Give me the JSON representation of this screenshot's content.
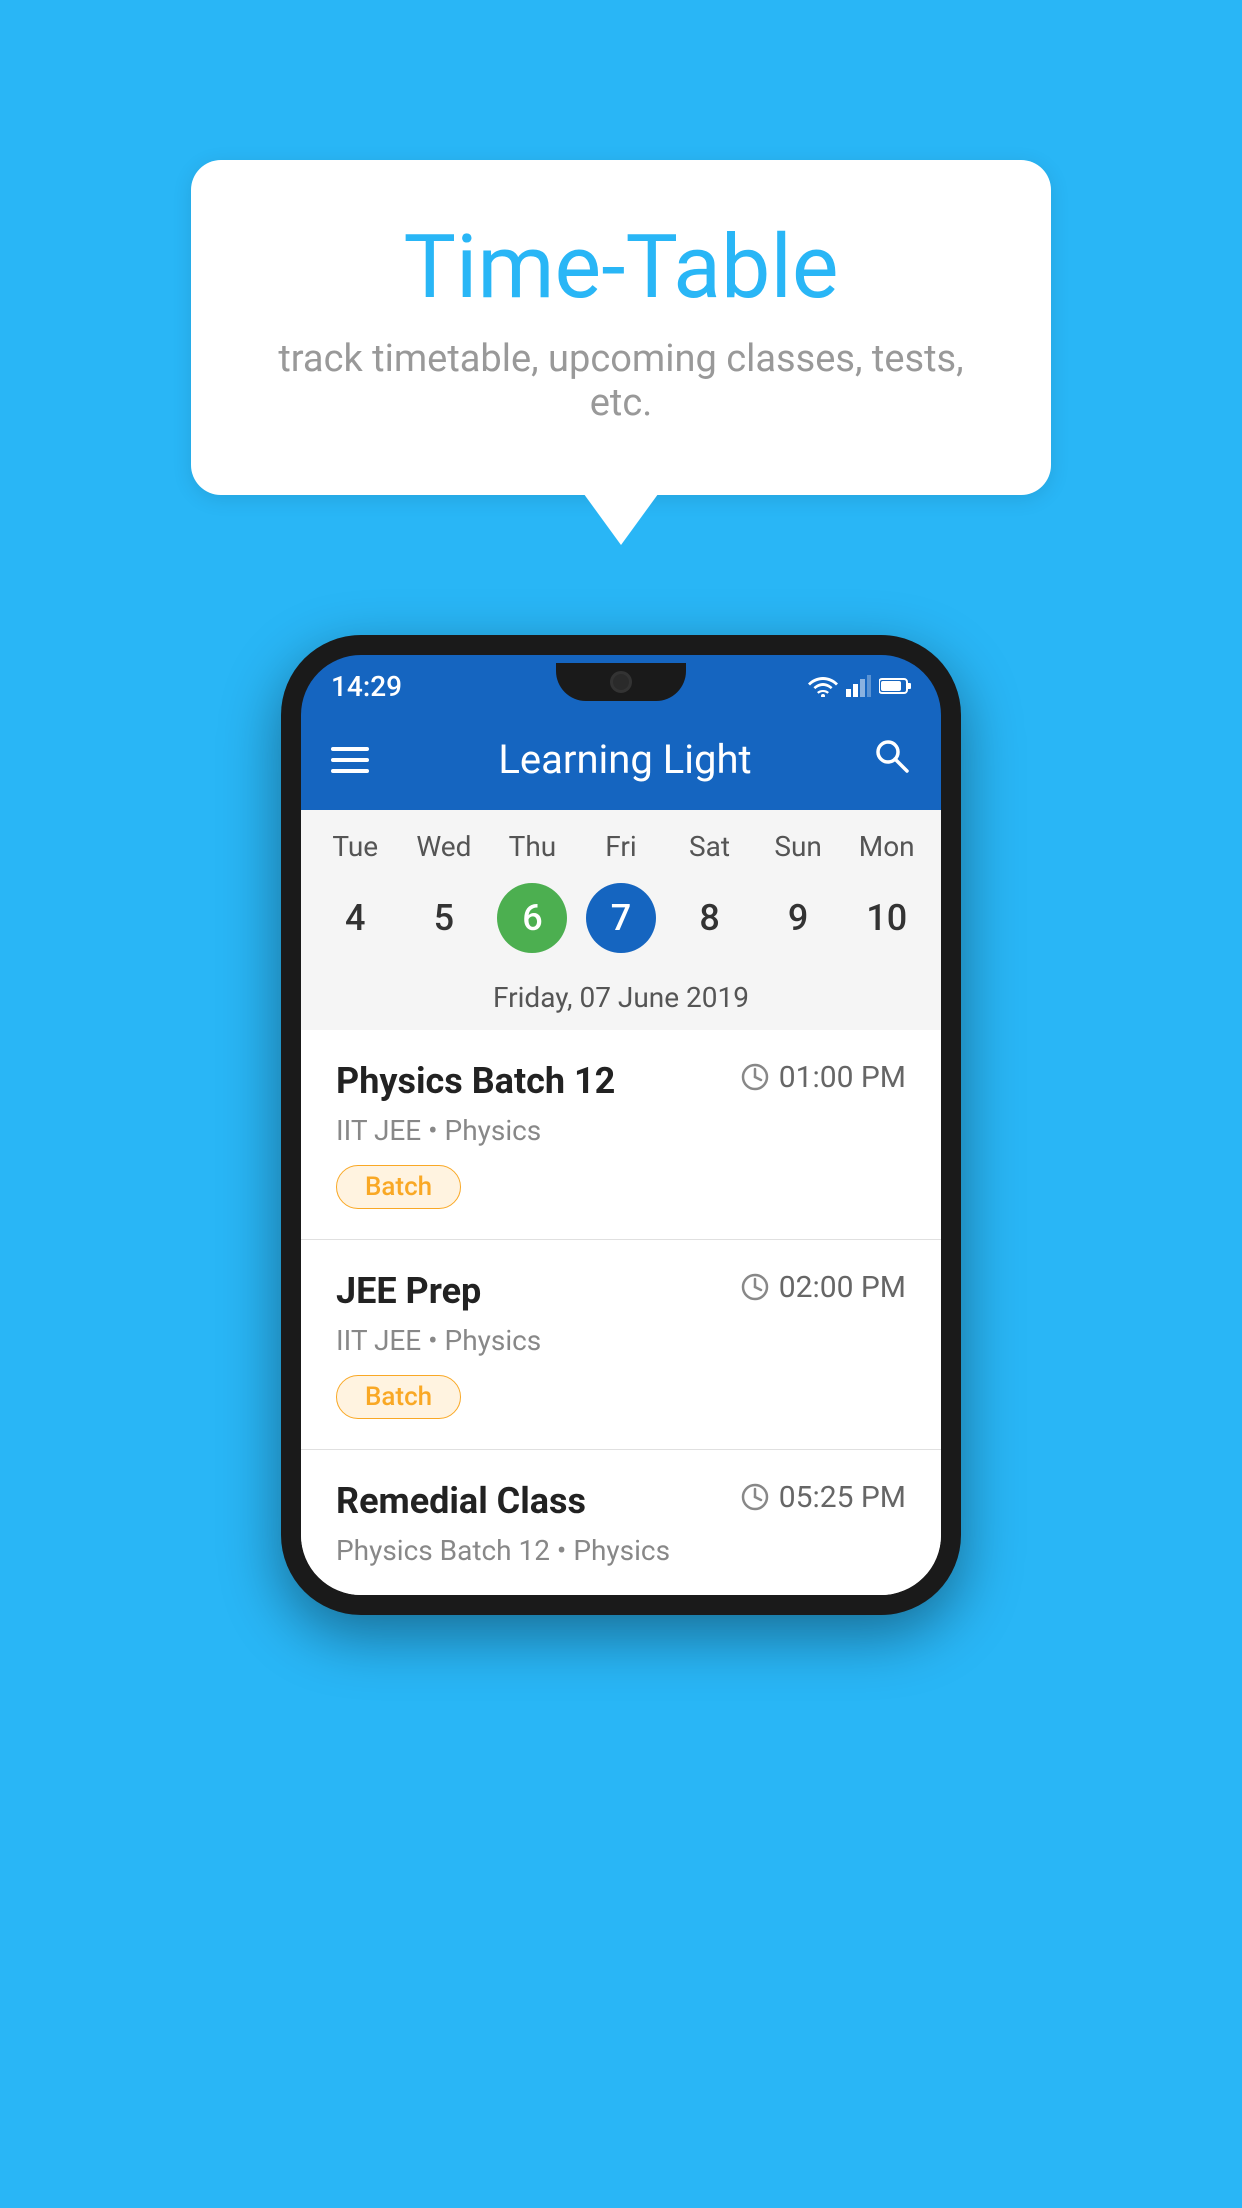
{
  "background_color": "#29B6F6",
  "speech_bubble": {
    "title": "Time-Table",
    "subtitle": "track timetable, upcoming classes, tests, etc."
  },
  "phone": {
    "status_bar": {
      "time": "14:29"
    },
    "app_bar": {
      "title": "Learning Light"
    },
    "calendar": {
      "days": [
        "Tue",
        "Wed",
        "Thu",
        "Fri",
        "Sat",
        "Sun",
        "Mon"
      ],
      "dates": [
        {
          "number": "4",
          "state": "normal"
        },
        {
          "number": "5",
          "state": "normal"
        },
        {
          "number": "6",
          "state": "today"
        },
        {
          "number": "7",
          "state": "selected"
        },
        {
          "number": "8",
          "state": "normal"
        },
        {
          "number": "9",
          "state": "normal"
        },
        {
          "number": "10",
          "state": "normal"
        }
      ],
      "selected_date_label": "Friday, 07 June 2019"
    },
    "schedule": [
      {
        "title": "Physics Batch 12",
        "time": "01:00 PM",
        "meta": "IIT JEE • Physics",
        "badge": "Batch"
      },
      {
        "title": "JEE Prep",
        "time": "02:00 PM",
        "meta": "IIT JEE • Physics",
        "badge": "Batch"
      },
      {
        "title": "Remedial Class",
        "time": "05:25 PM",
        "meta": "Physics Batch 12 • Physics",
        "badge": null
      }
    ]
  }
}
